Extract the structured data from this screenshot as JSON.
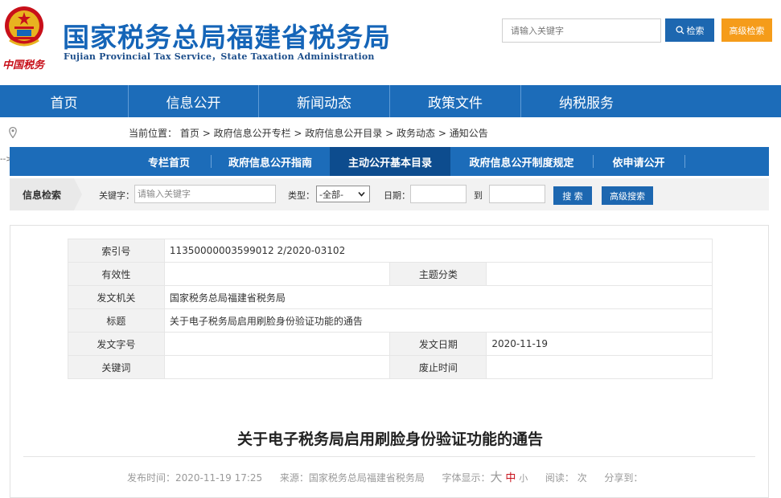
{
  "header": {
    "title": "国家税务总局福建省税务局",
    "subtitle": "Fujian Provincial Tax Service，State Taxation Administration",
    "brand_script": "中国税务",
    "search_placeholder": "请输入关键字",
    "search_button": "检索",
    "advanced_button": "高级检索"
  },
  "main_nav": [
    "首页",
    "信息公开",
    "新闻动态",
    "政策文件",
    "纳税服务"
  ],
  "breadcrumb": {
    "prefix": "当前位置：",
    "items": [
      "首页",
      "政府信息公开专栏",
      "政府信息公开目录",
      "政务动态",
      "通知公告"
    ],
    "separator": " > "
  },
  "arrow_mark": "-->",
  "sub_nav": [
    "专栏首页",
    "政府信息公开指南",
    "主动公开基本目录",
    "政府信息公开制度规定",
    "依申请公开"
  ],
  "filter": {
    "title": "信息检索",
    "keyword_label": "关键字：",
    "keyword_placeholder": "请输入关键字",
    "type_label": "类型：",
    "type_value": "-全部-",
    "date_label": "日期：",
    "to_label": "到",
    "search_button": "搜 索",
    "advanced_button": "高级搜索"
  },
  "meta": {
    "index_label": "索引号",
    "index_value": "11350000003599012 2/2020-03102",
    "validity_label": "有效性",
    "validity_value": "",
    "topic_label": "主题分类",
    "topic_value": "",
    "issuer_label": "发文机关",
    "issuer_value": "国家税务总局福建省税务局",
    "title_label": "标题",
    "title_value": "关于电子税务局启用刷脸身份验证功能的通告",
    "docno_label": "发文字号",
    "docno_value": "",
    "date_label": "发文日期",
    "date_value": "2020-11-19",
    "keywords_label": "关键词",
    "keywords_value": "",
    "expiry_label": "废止时间",
    "expiry_value": ""
  },
  "article": {
    "title": "关于电子税务局启用刷脸身份验证功能的通告",
    "publish_label": "发布时间：",
    "publish_time": "2020-11-19 17:25",
    "source_label": "来源：",
    "source_value": "国家税务总局福建省税务局",
    "font_label": "字体显示：",
    "font_large": "大",
    "font_medium": "中",
    "font_small": "小",
    "reads_label": "阅读：",
    "reads_suffix": "次",
    "share_label": "分享到："
  },
  "colors": {
    "brand_blue": "#1c6cb9",
    "active_tab": "#0d4c8e",
    "accent_orange": "#f59c1a",
    "emblem_red": "#c8101a"
  }
}
